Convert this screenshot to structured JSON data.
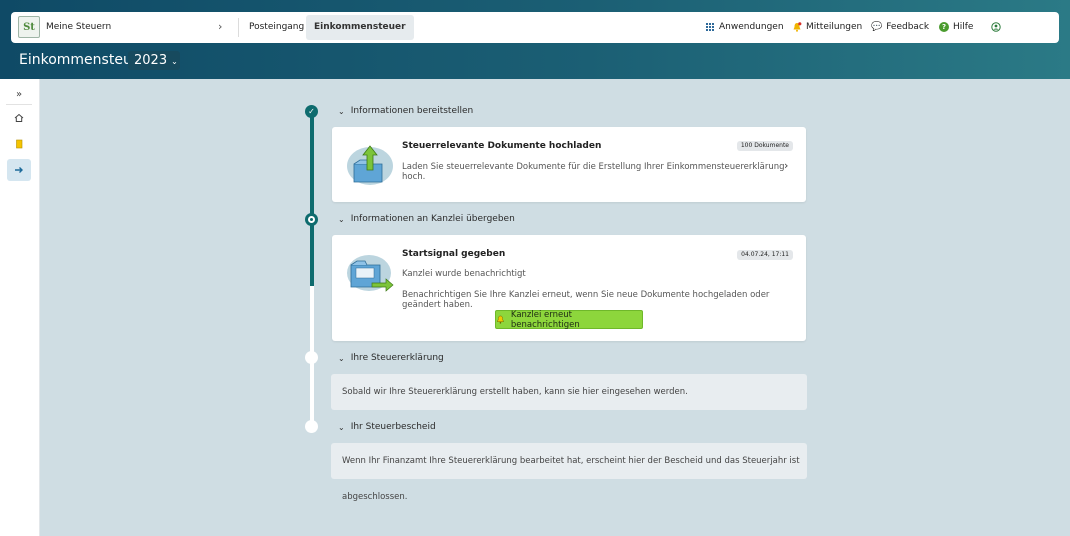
{
  "header": {
    "brand": "Meine Steuern",
    "logo_text": "St",
    "tabs": [
      {
        "label": "Posteingang"
      },
      {
        "label": "Einkommensteuer",
        "active": true
      }
    ],
    "right": {
      "apps": "Anwendungen",
      "messages": "Mitteilungen",
      "feedback": "Feedback",
      "help": "Hilfe",
      "help_icon_text": "?"
    },
    "page_title": "Einkommensteuer",
    "year": "2023"
  },
  "sidebar": {
    "items": [
      {
        "icon": "expand-icon"
      },
      {
        "icon": "home-icon"
      },
      {
        "icon": "document-icon"
      },
      {
        "icon": "arrow-right-icon",
        "active": true
      }
    ]
  },
  "timeline": {
    "sections": [
      {
        "title": "Informationen bereitstellen",
        "status": "done",
        "card": {
          "title": "Steuerrelevante Dokumente hochladen",
          "badge": "100 Dokumente",
          "text": "Laden Sie steuerrelevante Dokumente für die Erstellung Ihrer Einkommensteuererklärung hoch."
        }
      },
      {
        "title": "Informationen an Kanzlei übergeben",
        "status": "current",
        "card": {
          "title": "Startsignal gegeben",
          "badge": "04.07.24, 17:11",
          "text1": "Kanzlei wurde benachrichtigt",
          "text2": "Benachrichtigen Sie Ihre Kanzlei erneut, wenn Sie neue Dokumente hochgeladen oder geändert haben.",
          "button": "Kanzlei erneut benachrichtigen"
        }
      },
      {
        "title": "Ihre Steuererklärung",
        "status": "open",
        "info": "Sobald wir Ihre Steuererklärung erstellt haben, kann sie hier eingesehen werden."
      },
      {
        "title": "Ihr Steuerbescheid",
        "status": "open",
        "info": "Wenn Ihr Finanzamt Ihre Steuererklärung bearbeitet hat, erscheint hier der Bescheid und das Steuerjahr ist abgeschlossen."
      }
    ]
  },
  "colors": {
    "header_dark": "#0f4a66",
    "timeline": "#0e6b6e",
    "button_green": "#8dd63c",
    "background": "#cfdde3"
  }
}
